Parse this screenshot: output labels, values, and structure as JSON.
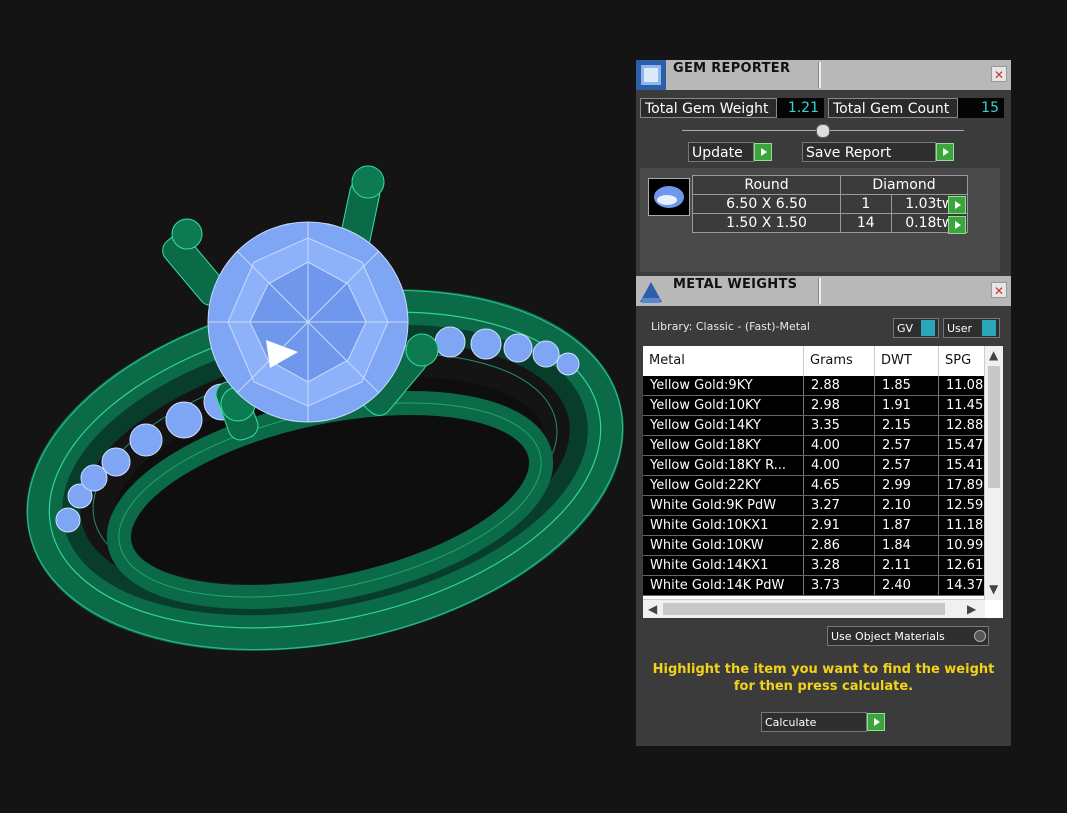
{
  "gem_reporter": {
    "title": "GEM REPORTER",
    "close_glyph": "✕",
    "total_weight_label": "Total Gem Weight",
    "total_weight_value": "1.21",
    "total_count_label": "Total Gem Count",
    "total_count_value": "15",
    "update_label": "Update",
    "save_report_label": "Save Report",
    "shape_header": "Round",
    "type_header": "Diamond",
    "rows": [
      {
        "size": "6.50 X 6.50",
        "count": "1",
        "weight": "1.03tw"
      },
      {
        "size": "1.50 X 1.50",
        "count": "14",
        "weight": "0.18tw"
      }
    ]
  },
  "metal_weights": {
    "title": "METAL WEIGHTS",
    "close_glyph": "✕",
    "library_label": "Library: Classic - (Fast)-Metal",
    "gv_label": "GV",
    "user_label": "User",
    "columns": [
      "Metal",
      "Grams",
      "DWT",
      "SPG"
    ],
    "rows": [
      {
        "metal": "Yellow Gold:9KY",
        "grams": "2.88",
        "dwt": "1.85",
        "spg": "11.08"
      },
      {
        "metal": "Yellow Gold:10KY",
        "grams": "2.98",
        "dwt": "1.91",
        "spg": "11.45"
      },
      {
        "metal": "Yellow Gold:14KY",
        "grams": "3.35",
        "dwt": "2.15",
        "spg": "12.88"
      },
      {
        "metal": "Yellow Gold:18KY",
        "grams": "4.00",
        "dwt": "2.57",
        "spg": "15.47"
      },
      {
        "metal": "Yellow Gold:18KY R...",
        "grams": "4.00",
        "dwt": "2.57",
        "spg": "15.41"
      },
      {
        "metal": "Yellow Gold:22KY",
        "grams": "4.65",
        "dwt": "2.99",
        "spg": "17.89"
      },
      {
        "metal": "White Gold:9K PdW",
        "grams": "3.27",
        "dwt": "2.10",
        "spg": "12.59"
      },
      {
        "metal": "White Gold:10KX1",
        "grams": "2.91",
        "dwt": "1.87",
        "spg": "11.18"
      },
      {
        "metal": "White Gold:10KW",
        "grams": "2.86",
        "dwt": "1.84",
        "spg": "10.99"
      },
      {
        "metal": "White Gold:14KX1",
        "grams": "3.28",
        "dwt": "2.11",
        "spg": "12.61"
      },
      {
        "metal": "White Gold:14K PdW",
        "grams": "3.73",
        "dwt": "2.40",
        "spg": "14.37"
      }
    ],
    "use_object_materials_label": "Use Object Materials",
    "instruction_line1": "Highlight the item you want to find the weight",
    "instruction_line2": "for then press calculate.",
    "calculate_label": "Calculate"
  },
  "colors": {
    "ring_metal": "#0b6b48",
    "ring_edge": "#35e0a0",
    "gem": "#7ea6f5",
    "value_text": "#33d6d6",
    "instruction_text": "#f2d21b"
  }
}
